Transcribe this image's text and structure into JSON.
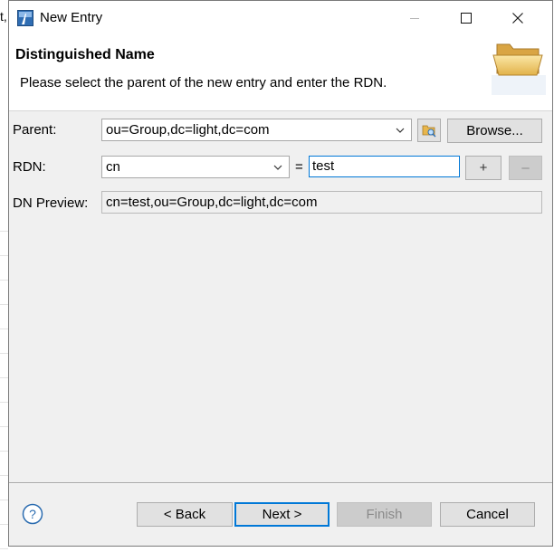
{
  "window": {
    "title": "New Entry"
  },
  "header": {
    "title": "Distinguished Name",
    "description": "Please select the parent of the new entry and enter the RDN."
  },
  "form": {
    "parent_label": "Parent:",
    "parent_value": "ou=Group,dc=light,dc=com",
    "browse_label": "Browse...",
    "rdn_label": "RDN:",
    "rdn_attribute": "cn",
    "equals": "=",
    "rdn_value": "test",
    "add_label": "+",
    "remove_label": "–",
    "preview_label": "DN Preview:",
    "preview_value": "cn=test,ou=Group,dc=light,dc=com"
  },
  "footer": {
    "help_label": "?",
    "back_label": "< Back",
    "next_label": "Next >",
    "finish_label": "Finish",
    "cancel_label": "Cancel"
  },
  "background": {
    "fragment": "t,"
  },
  "colors": {
    "accent": "#0078d7",
    "dialog_bg": "#f0f0f0",
    "button_bg": "#e1e1e1"
  }
}
